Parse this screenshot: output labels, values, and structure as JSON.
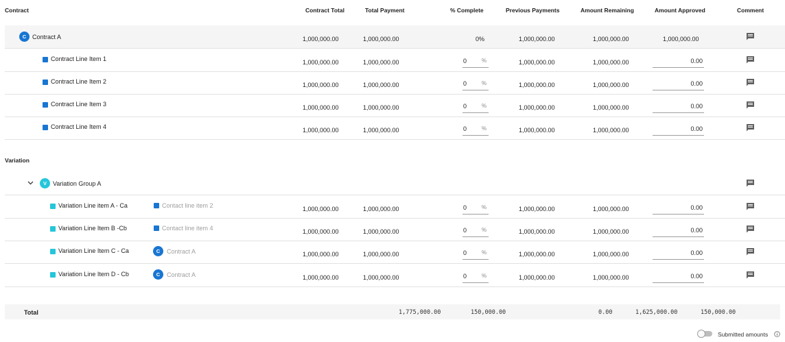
{
  "columns": {
    "contract": "Contract",
    "contract_total": "Contract Total",
    "total_payment": "Total Payment",
    "pct_complete": "% Complete",
    "previous_payments": "Previous Payments",
    "amount_remaining": "Amount Remaining",
    "amount_approved": "Amount Approved",
    "comment": "Comment"
  },
  "contract_parent": {
    "badge": "C",
    "name": "Contract A",
    "contract_total": "1,000,000.00",
    "total_payment": "1,000,000.00",
    "pct_complete": "0%",
    "previous_payments": "1,000,000.00",
    "amount_remaining": "1,000,000.00",
    "amount_approved": "1,000,000.00"
  },
  "contract_lines": [
    {
      "name": "Contract Line Item 1",
      "contract_total": "1,000,000.00",
      "total_payment": "1,000,000.00",
      "pct": "0",
      "pct_unit": "%",
      "previous_payments": "1,000,000.00",
      "amount_remaining": "1,000,000.00",
      "amount_approved": "0.00"
    },
    {
      "name": "Contract Line Item 2",
      "contract_total": "1,000,000.00",
      "total_payment": "1,000,000.00",
      "pct": "0",
      "pct_unit": "%",
      "previous_payments": "1,000,000.00",
      "amount_remaining": "1,000,000.00",
      "amount_approved": "0.00"
    },
    {
      "name": "Contract Line Item 3",
      "contract_total": "1,000,000.00",
      "total_payment": "1,000,000.00",
      "pct": "0",
      "pct_unit": "%",
      "previous_payments": "1,000,000.00",
      "amount_remaining": "1,000,000.00",
      "amount_approved": "0.00"
    },
    {
      "name": "Contract Line Item 4",
      "contract_total": "1,000,000.00",
      "total_payment": "1,000,000.00",
      "pct": "0",
      "pct_unit": "%",
      "previous_payments": "1,000,000.00",
      "amount_remaining": "1,000,000.00",
      "amount_approved": "0.00"
    }
  ],
  "variation_section": {
    "title": "Variation",
    "group": {
      "badge": "V",
      "name": "Variation Group A"
    }
  },
  "variation_lines": [
    {
      "name": "Variation Line item A - Ca",
      "link_type": "square",
      "link": "Contact line item 2",
      "contract_total": "1,000,000.00",
      "total_payment": "1,000,000.00",
      "pct": "0",
      "pct_unit": "%",
      "previous_payments": "1,000,000.00",
      "amount_remaining": "1,000,000.00",
      "amount_approved": "0.00"
    },
    {
      "name": "Variation Line Item B -Cb",
      "link_type": "square",
      "link": "Contact line item 4",
      "contract_total": "1,000,000.00",
      "total_payment": "1,000,000.00",
      "pct": "0",
      "pct_unit": "%",
      "previous_payments": "1,000,000.00",
      "amount_remaining": "1,000,000.00",
      "amount_approved": "0.00"
    },
    {
      "name": "Variation Line Item C - Ca",
      "link_type": "badge",
      "link_badge": "C",
      "link": "Contract A",
      "contract_total": "1,000,000.00",
      "total_payment": "1,000,000.00",
      "pct": "0",
      "pct_unit": "%",
      "previous_payments": "1,000,000.00",
      "amount_remaining": "1,000,000.00",
      "amount_approved": "0.00"
    },
    {
      "name": "Variation Line Item D - Cb",
      "link_type": "badge",
      "link_badge": "C",
      "link": "Contract A",
      "contract_total": "1,000,000.00",
      "total_payment": "1,000,000.00",
      "pct": "0",
      "pct_unit": "%",
      "previous_payments": "1,000,000.00",
      "amount_remaining": "1,000,000.00",
      "amount_approved": "0.00"
    }
  ],
  "total": {
    "label": "Total",
    "v1": "1,775,000.00",
    "v2": "150,000.00",
    "v3": "0.00",
    "v4": "1,625,000.00",
    "v5": "150,000.00"
  },
  "footer": {
    "toggle_label": "Submitted amounts"
  },
  "icons": {
    "comment": "comment-icon",
    "chevron": "chevron-down-icon",
    "info": "info-icon"
  },
  "colors": {
    "contract_blue": "#1976d2",
    "variation_teal": "#26c6da",
    "icon_gray": "#616161"
  }
}
